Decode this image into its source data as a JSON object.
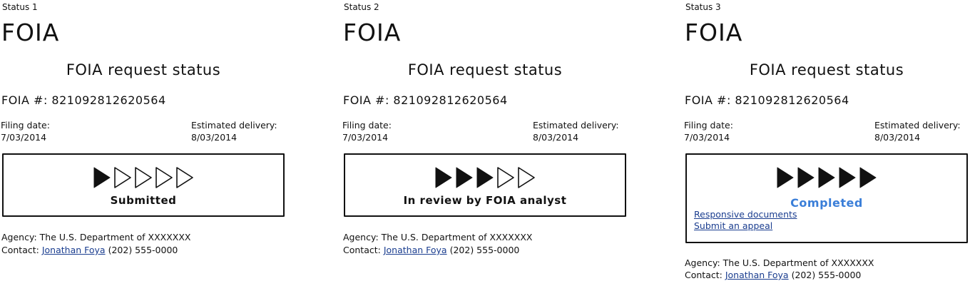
{
  "panels": [
    {
      "status_label": "Status 1",
      "app_title": "FOIA",
      "page_title": "FOIA request status",
      "foia_number": "FOIA #: 821092812620564",
      "filing_date_label": "Filing date:",
      "filing_date": "7/03/2014",
      "delivery_label": "Estimated delivery:",
      "delivery_date": "8/03/2014",
      "progress": {
        "filled": 1,
        "total": 5
      },
      "state": "Submitted",
      "agency": "Agency: The U.S. Department of XXXXXXX",
      "contact_prefix": "Contact:",
      "contact_name": "Jonathan Foya",
      "contact_phone": "(202) 555-0000"
    },
    {
      "status_label": "Status 2",
      "app_title": "FOIA",
      "page_title": "FOIA request status",
      "foia_number": "FOIA #: 821092812620564",
      "filing_date_label": "Filing date:",
      "filing_date": "7/03/2014",
      "delivery_label": "Estimated delivery:",
      "delivery_date": "8/03/2014",
      "progress": {
        "filled": 3,
        "total": 5
      },
      "state": "In review by FOIA analyst",
      "agency": "Agency: The U.S. Department of XXXXXXX",
      "contact_prefix": "Contact:",
      "contact_name": "Jonathan Foya",
      "contact_phone": "(202) 555-0000"
    },
    {
      "status_label": "Status 3",
      "app_title": "FOIA",
      "page_title": "FOIA request status",
      "foia_number": "FOIA #: 821092812620564",
      "filing_date_label": "Filing date:",
      "filing_date": "7/03/2014",
      "delivery_label": "Estimated delivery:",
      "delivery_date": "8/03/2014",
      "progress": {
        "filled": 5,
        "total": 5
      },
      "state": "Completed",
      "links": [
        "Responsive documents",
        "Submit an appeal"
      ],
      "agency": "Agency: The U.S. Department of XXXXXXX",
      "contact_prefix": "Contact:",
      "contact_name": "Jonathan Foya",
      "contact_phone": "(202) 555-0000"
    }
  ],
  "colors": {
    "text": "#111111",
    "link": "#1a3d8f",
    "completed": "#3a7ed8"
  }
}
